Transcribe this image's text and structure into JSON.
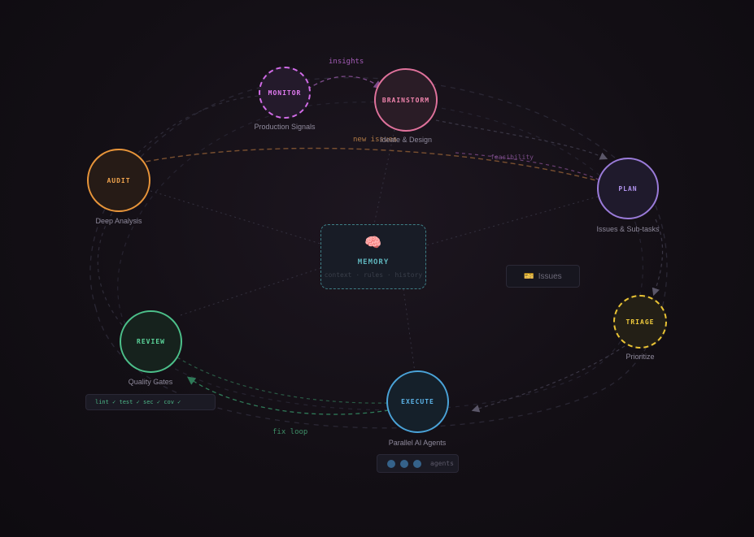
{
  "colors": {
    "background": "#130f15",
    "monitor": "#d06be6",
    "brainstorm": "#e0729c",
    "plan": "#9a7bd9",
    "triage": "#e8c234",
    "execute": "#4aa3d8",
    "review": "#4cc08a",
    "audit": "#e8953a",
    "memory": "#4fa3aa"
  },
  "nodes": {
    "monitor": {
      "label": "MONITOR",
      "subtitle": "Production Signals"
    },
    "brainstorm": {
      "label": "BRAINSTORM",
      "subtitle": "Ideate & Design"
    },
    "plan": {
      "label": "PLAN",
      "subtitle": "Issues & Sub-tasks"
    },
    "triage": {
      "label": "TRIAGE",
      "subtitle": "Prioritize"
    },
    "execute": {
      "label": "EXECUTE",
      "subtitle": "Parallel AI Agents"
    },
    "review": {
      "label": "REVIEW",
      "subtitle": "Quality Gates"
    },
    "audit": {
      "label": "AUDIT",
      "subtitle": "Deep Analysis"
    }
  },
  "memory": {
    "icon": "brain-icon",
    "icon_glyph": "🧠",
    "title": "MEMORY",
    "subtitle": "context · rules · history"
  },
  "edge_labels": {
    "insights": "insights",
    "new_issues": "new issues",
    "feasibility": "feasibility",
    "fix_loop": "fix loop"
  },
  "chips": {
    "issues": {
      "icon": "ticket-icon",
      "icon_glyph": "🎫",
      "label": "Issues"
    },
    "review_checks": "lint ✓ test ✓ sec ✓ cov ✓",
    "agents": {
      "label": "agents",
      "dot_count": 3
    }
  }
}
